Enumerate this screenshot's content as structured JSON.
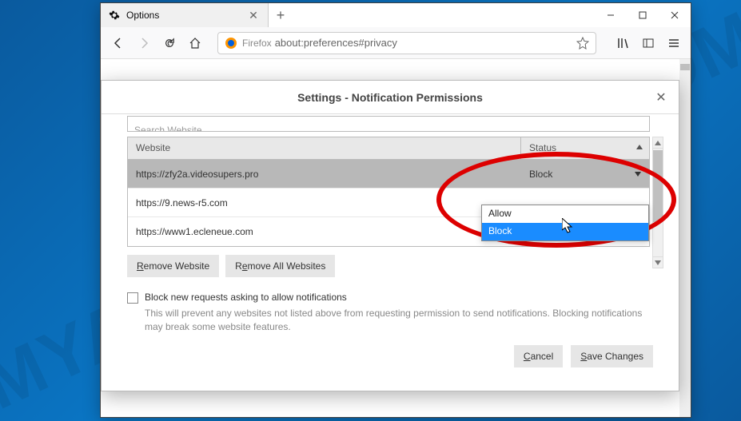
{
  "watermark": "MYANTISPYWARE.COM",
  "window": {
    "tab_label": "Options",
    "url_prefix": "Firefox",
    "url": "about:preferences#privacy"
  },
  "dialog": {
    "title": "Settings - Notification Permissions",
    "search_placeholder": "Search Website",
    "columns": {
      "website": "Website",
      "status": "Status"
    },
    "rows": [
      {
        "website": "https://zfy2a.videosupers.pro",
        "status": "Block",
        "selected": true
      },
      {
        "website": "https://9.news-r5.com",
        "status": "",
        "selected": false
      },
      {
        "website": "https://www1.ecleneue.com",
        "status": "",
        "selected": false
      }
    ],
    "dropdown": {
      "options": [
        "Allow",
        "Block"
      ],
      "highlight": "Block"
    },
    "remove_website": "Remove Website",
    "remove_all": "Remove All Websites",
    "checkbox_label": "Block new requests asking to allow notifications",
    "checkbox_desc": "This will prevent any websites not listed above from requesting permission to send notifications. Blocking notifications may break some website features.",
    "cancel": "Cancel",
    "save": "Save Changes"
  }
}
